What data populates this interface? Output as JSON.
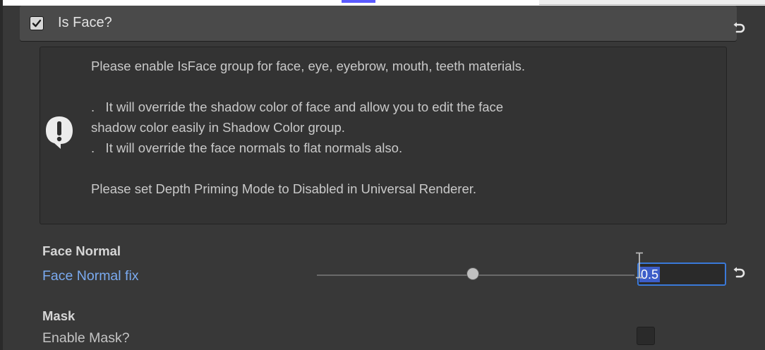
{
  "is_face_section": {
    "title": "Is Face?",
    "enabled": true
  },
  "help_box": {
    "icon": "help-bubble-icon",
    "lines": [
      "Please enable IsFace group for face, eye, eyebrow, mouth, teeth materials.",
      ".   It will override the shadow color of face and allow you to edit the face",
      "shadow color easily in Shadow Color group.",
      ".   It will override the face normals to flat normals also.",
      "Please set Depth Priming Mode to Disabled in Universal Renderer."
    ]
  },
  "face_normal": {
    "header": "Face Normal",
    "fix_label": "Face Normal fix",
    "fix_value": "0.5",
    "fix_fraction": 0.5
  },
  "mask": {
    "header": "Mask",
    "enable_label": "Enable Mask?",
    "enabled": false
  },
  "colors": {
    "background": "#383838",
    "foldout_header": "#4a4a4a",
    "overridden_label": "#7aaaf0",
    "field_focus": "#3a79d9",
    "text_selection": "#3d5ec9"
  },
  "icons": [
    "checkmark-icon",
    "revert-icon",
    "help-bubble-icon",
    "text-cursor-icon"
  ]
}
